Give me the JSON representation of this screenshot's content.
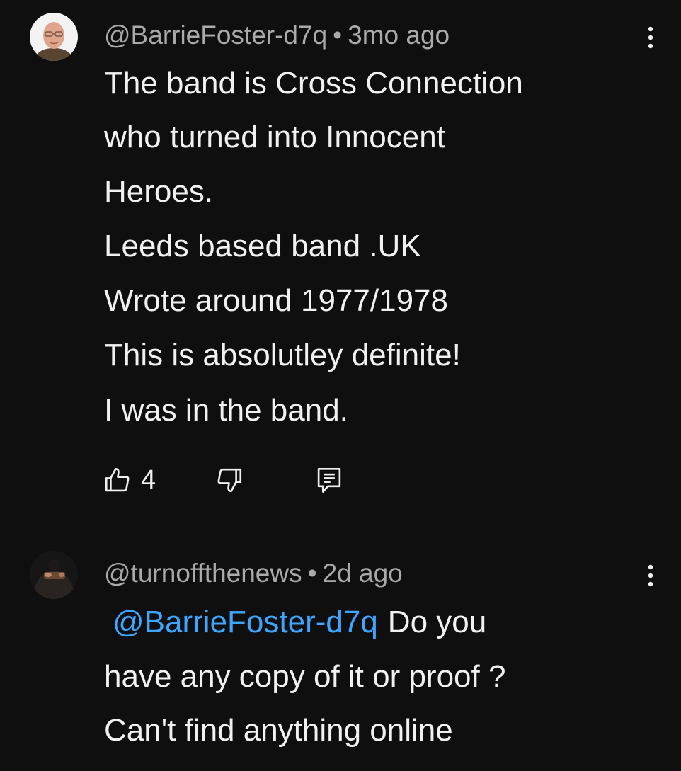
{
  "comments": [
    {
      "handle": "@BarrieFoster-d7q",
      "separator": "•",
      "time": "3mo ago",
      "lines": [
        "The band is Cross Connection",
        "who turned into Innocent",
        "Heroes.",
        "Leeds based band .UK",
        "Wrote around 1977/1978",
        "This is absolutley definite!",
        "I was in the band."
      ],
      "like_count": "4",
      "icons": {
        "avatar": "avatar-icon",
        "like": "thumbs-up-icon",
        "dislike": "thumbs-down-icon",
        "reply": "reply-icon",
        "more": "more-vertical-icon"
      }
    },
    {
      "handle": "@turnoffthenews",
      "separator": "•",
      "time": "2d ago",
      "mention": "@BarrieFoster-d7q",
      "line1_rest": "Do you",
      "lines": [
        "have any copy of it or proof ?",
        "Can't find anything online"
      ],
      "icons": {
        "avatar": "avatar-icon",
        "more": "more-vertical-icon"
      }
    }
  ],
  "colors": {
    "background": "#0f0f0f",
    "text": "#f1f1f1",
    "secondary_text": "#aaaaaa",
    "mention": "#3ea6ff"
  }
}
